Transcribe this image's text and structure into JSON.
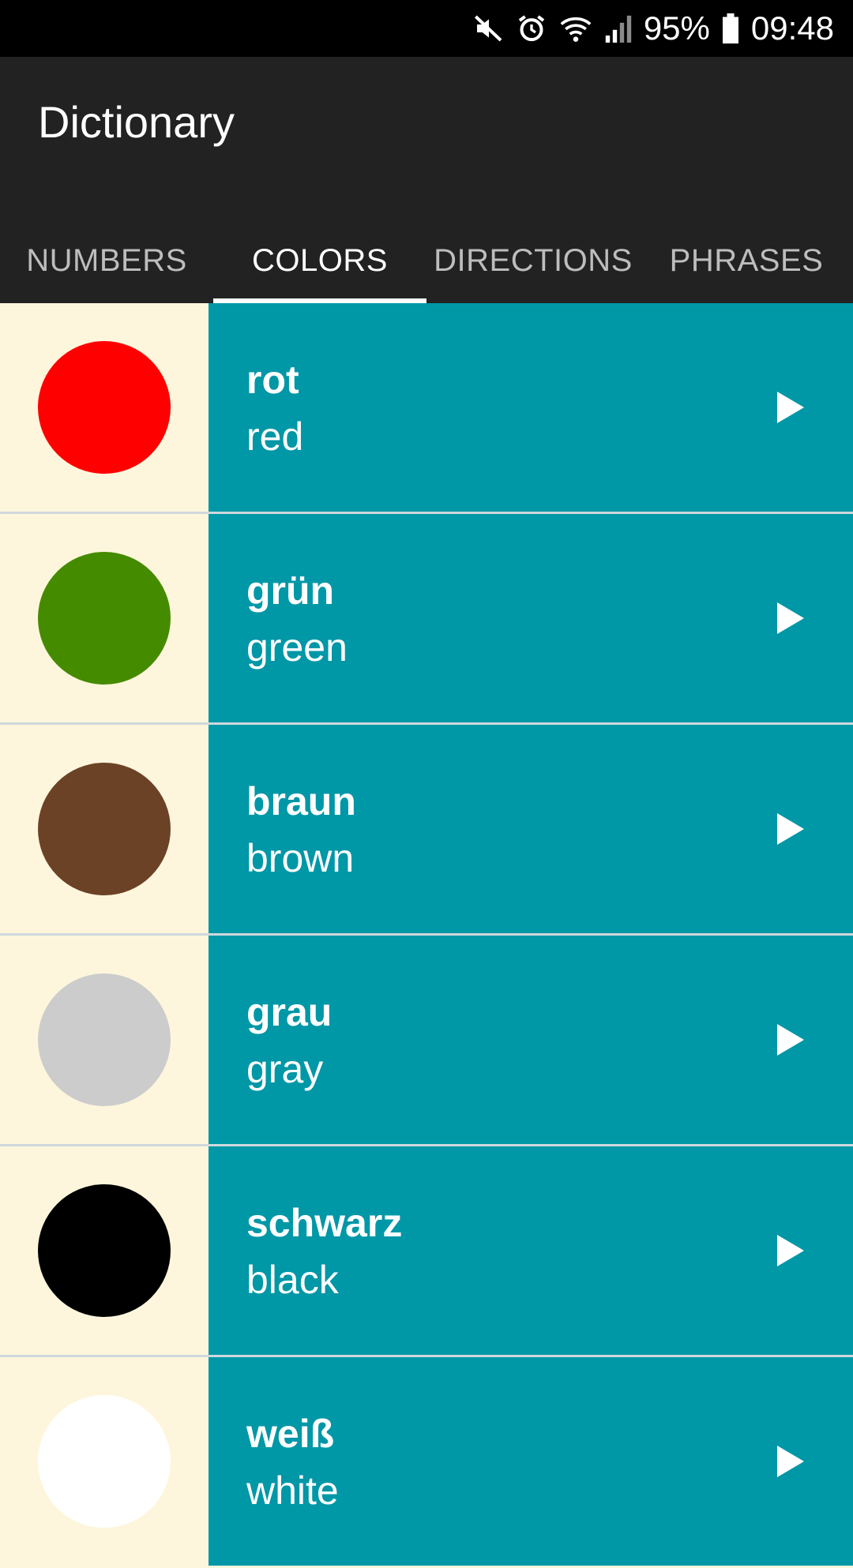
{
  "status_bar": {
    "battery_percent": "95%",
    "time": "09:48"
  },
  "app_bar": {
    "title": "Dictionary"
  },
  "tabs": [
    {
      "label": "NUMBERS",
      "active": false
    },
    {
      "label": "COLORS",
      "active": true
    },
    {
      "label": "DIRECTIONS",
      "active": false
    },
    {
      "label": "PHRASES",
      "active": false
    }
  ],
  "colors": {
    "status_bar_bg": "#000000",
    "app_bar_bg": "#222222",
    "list_text_bg": "#0097a7",
    "image_bg": "#fdf6dc"
  },
  "words": [
    {
      "german": "rot",
      "english": "red",
      "swatch": "#ff0000"
    },
    {
      "german": "grün",
      "english": "green",
      "swatch": "#458b00"
    },
    {
      "german": "braun",
      "english": "brown",
      "swatch": "#6b4226"
    },
    {
      "german": "grau",
      "english": "gray",
      "swatch": "#cccccc"
    },
    {
      "german": "schwarz",
      "english": "black",
      "swatch": "#000000"
    },
    {
      "german": "weiß",
      "english": "white",
      "swatch": "#ffffff"
    }
  ]
}
